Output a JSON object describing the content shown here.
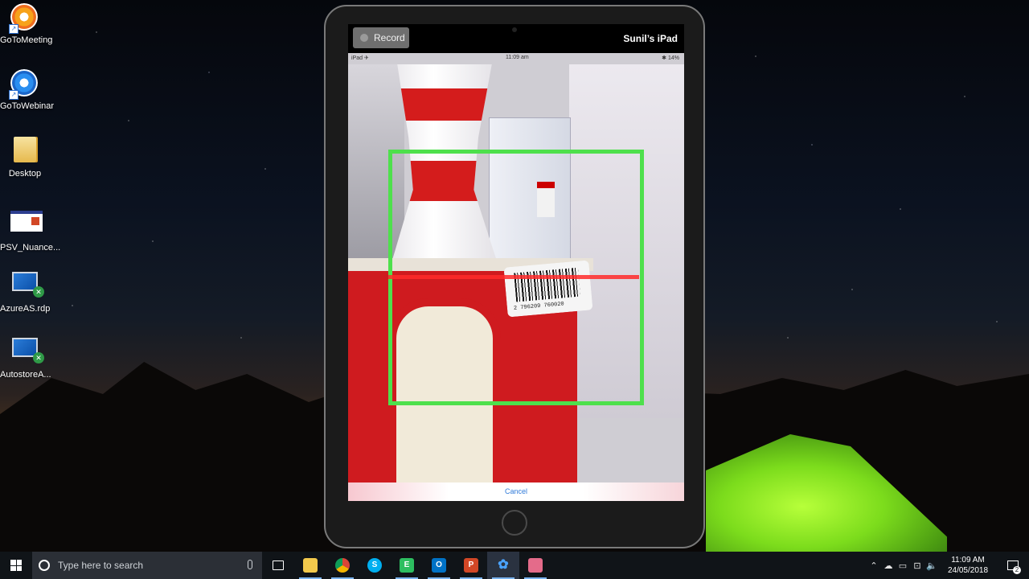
{
  "desktop": {
    "icons": [
      {
        "label": "GoToMeeting",
        "icon": "gotomeeting-icon",
        "color1": "#f7a21a",
        "color2": "#ef6c1e"
      },
      {
        "label": "GoToWebinar",
        "icon": "gotowebinar-icon",
        "color1": "#2a8ef0",
        "color2": "#1b66c9"
      },
      {
        "label": "Desktop",
        "icon": "folder-icon"
      },
      {
        "label": "PSV_Nuance...",
        "icon": "powerpoint-file-icon"
      },
      {
        "label": "AzureAS.rdp",
        "icon": "remote-desktop-icon"
      },
      {
        "label": "AutostoreA...",
        "icon": "remote-desktop-icon"
      }
    ]
  },
  "ipad_window": {
    "record_label": "Record",
    "device_name": "Sunil’s iPad",
    "status_left": "iPad ✈︎",
    "status_center": "11:09 am",
    "status_right": "✱ 14%",
    "barcode_digits": "2 796209 760020",
    "cancel_label": "Cancel",
    "scan_box_color": "#4ee04c",
    "scan_line_color": "#ff2a2a"
  },
  "taskbar": {
    "search_placeholder": "Type here to search",
    "apps": [
      {
        "name": "task-view",
        "glyph": "▭"
      },
      {
        "name": "file-explorer",
        "glyph": "📁"
      },
      {
        "name": "chrome",
        "glyph": "◉"
      },
      {
        "name": "skype",
        "glyph": "S"
      },
      {
        "name": "evernote",
        "glyph": "E"
      },
      {
        "name": "outlook",
        "glyph": "O"
      },
      {
        "name": "powerpoint",
        "glyph": "P"
      },
      {
        "name": "gotowebinar",
        "glyph": "✿"
      },
      {
        "name": "app-generic",
        "glyph": "▣"
      }
    ],
    "clock_time": "11:09 AM",
    "clock_date": "24/05/2018",
    "notification_count": "2"
  }
}
